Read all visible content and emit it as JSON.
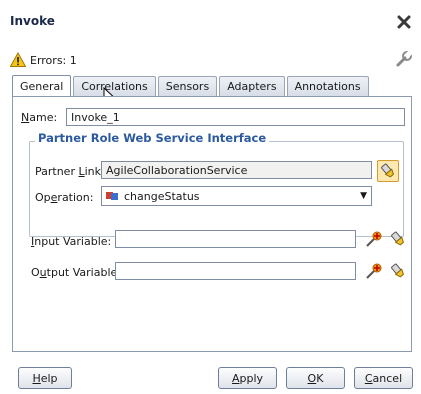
{
  "dialog": {
    "title": "Invoke",
    "errors_text": "Errors: 1"
  },
  "tabs": [
    {
      "label": "General",
      "active": true
    },
    {
      "label": "Correlations",
      "active": false
    },
    {
      "label": "Sensors",
      "active": false
    },
    {
      "label": "Adapters",
      "active": false
    },
    {
      "label": "Annotations",
      "active": false
    }
  ],
  "general": {
    "name_label_mnemonic": "N",
    "name_label_rest": "ame:",
    "name_value": "Invoke_1",
    "group_title": "Partner Role Web Service Interface",
    "partner_link_label_pre": "Partner ",
    "partner_link_label_mnemonic": "L",
    "partner_link_label_post": "ink:",
    "partner_link_value": "AgileCollaborationService",
    "operation_label_pre": "Op",
    "operation_label_mnemonic": "e",
    "operation_label_post": "ration:",
    "operation_value": "changeStatus",
    "input_label_mnemonic": "I",
    "input_label_rest": "nput Variable:",
    "input_value": "",
    "output_label_pre": "O",
    "output_label_mnemonic": "u",
    "output_label_post": "tput Variable:",
    "output_value": ""
  },
  "buttons": {
    "help_mnemonic": "H",
    "help_rest": "elp",
    "apply_mnemonic": "A",
    "apply_rest": "pply",
    "ok_mnemonic": "O",
    "ok_rest": "K",
    "cancel_mnemonic": "C",
    "cancel_rest": "ancel"
  },
  "colors": {
    "group_title": "#2c5aa0",
    "panel_border": "#8c9ab0",
    "title_text": "#1b2a4a"
  },
  "icons": {
    "close": "close-x-icon",
    "warning": "warning-icon",
    "wrench": "wrench-icon",
    "partner_link_browse": "flashlight-browse-icon",
    "create_variable": "add-variable-icon",
    "browse_variable": "flashlight-browse-icon",
    "operation": "operation-icon"
  }
}
